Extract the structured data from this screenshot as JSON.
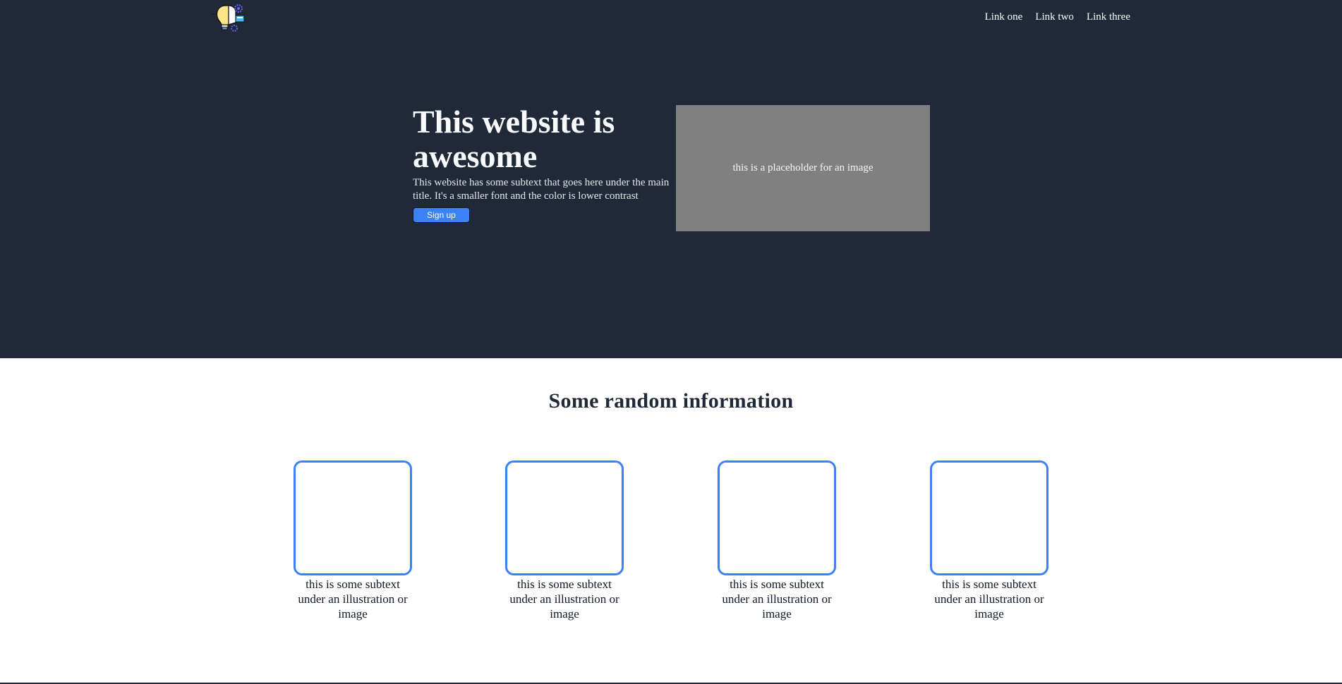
{
  "nav": {
    "links": [
      "Link one",
      "Link two",
      "Link three"
    ]
  },
  "hero": {
    "title": "This website is awesome",
    "subtext": "This website has some subtext that goes here under the main title. It's a smaller font and the color is lower contrast",
    "signup_label": "Sign up",
    "image_placeholder": "this is a placeholder for an image"
  },
  "info": {
    "title": "Some random information",
    "cards": [
      {
        "caption": "this is some subtext under an illustration or image"
      },
      {
        "caption": "this is some subtext under an illustration or image"
      },
      {
        "caption": "this is some subtext under an illustration or image"
      },
      {
        "caption": "this is some subtext under an illustration or image"
      }
    ]
  },
  "colors": {
    "hero_bg": "#1f2937",
    "accent": "#3b82f6",
    "placeholder_bg": "#808080"
  },
  "icons": {
    "logo": "lightbulb-gear-logo-icon"
  }
}
